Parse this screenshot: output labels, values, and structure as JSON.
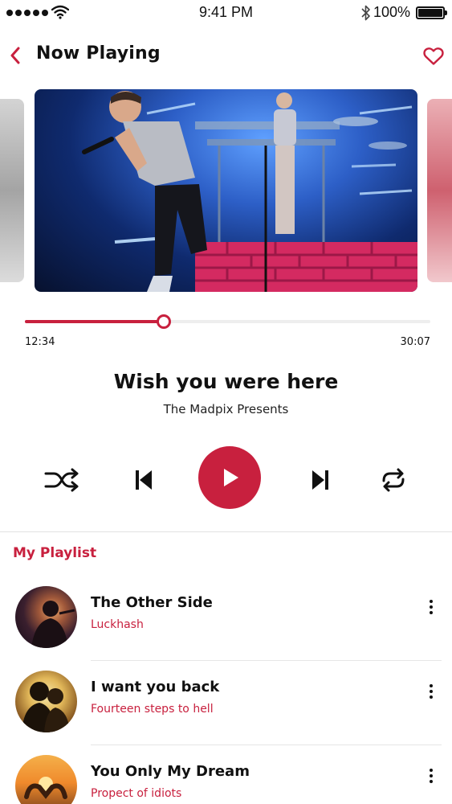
{
  "status_bar": {
    "time": "9:41 PM",
    "battery": "100%",
    "battery_level": 1.0,
    "signal_dots": 5
  },
  "header": {
    "title": "Now Playing",
    "back_icon": "chevron-left-icon",
    "favorite_icon": "heart-icon"
  },
  "player": {
    "current_time": "12:34",
    "total_time": "30:07",
    "progress": 0.342,
    "title": "Wish you were here",
    "artist": "The Madpix Presents"
  },
  "controls": {
    "shuffle_icon": "shuffle-icon",
    "previous_icon": "skip-previous-icon",
    "play_icon": "play-icon",
    "next_icon": "skip-next-icon",
    "repeat_icon": "repeat-icon"
  },
  "playlist": {
    "title": "My Playlist",
    "items": [
      {
        "song": "The Other Side",
        "artist": "Luckhash"
      },
      {
        "song": "I want you back",
        "artist": "Fourteen steps to hell"
      },
      {
        "song": "You Only My Dream",
        "artist": "Propect of idiots"
      }
    ]
  },
  "colors": {
    "accent": "#c8203e",
    "text": "#111111",
    "track": "#eeeeee"
  }
}
